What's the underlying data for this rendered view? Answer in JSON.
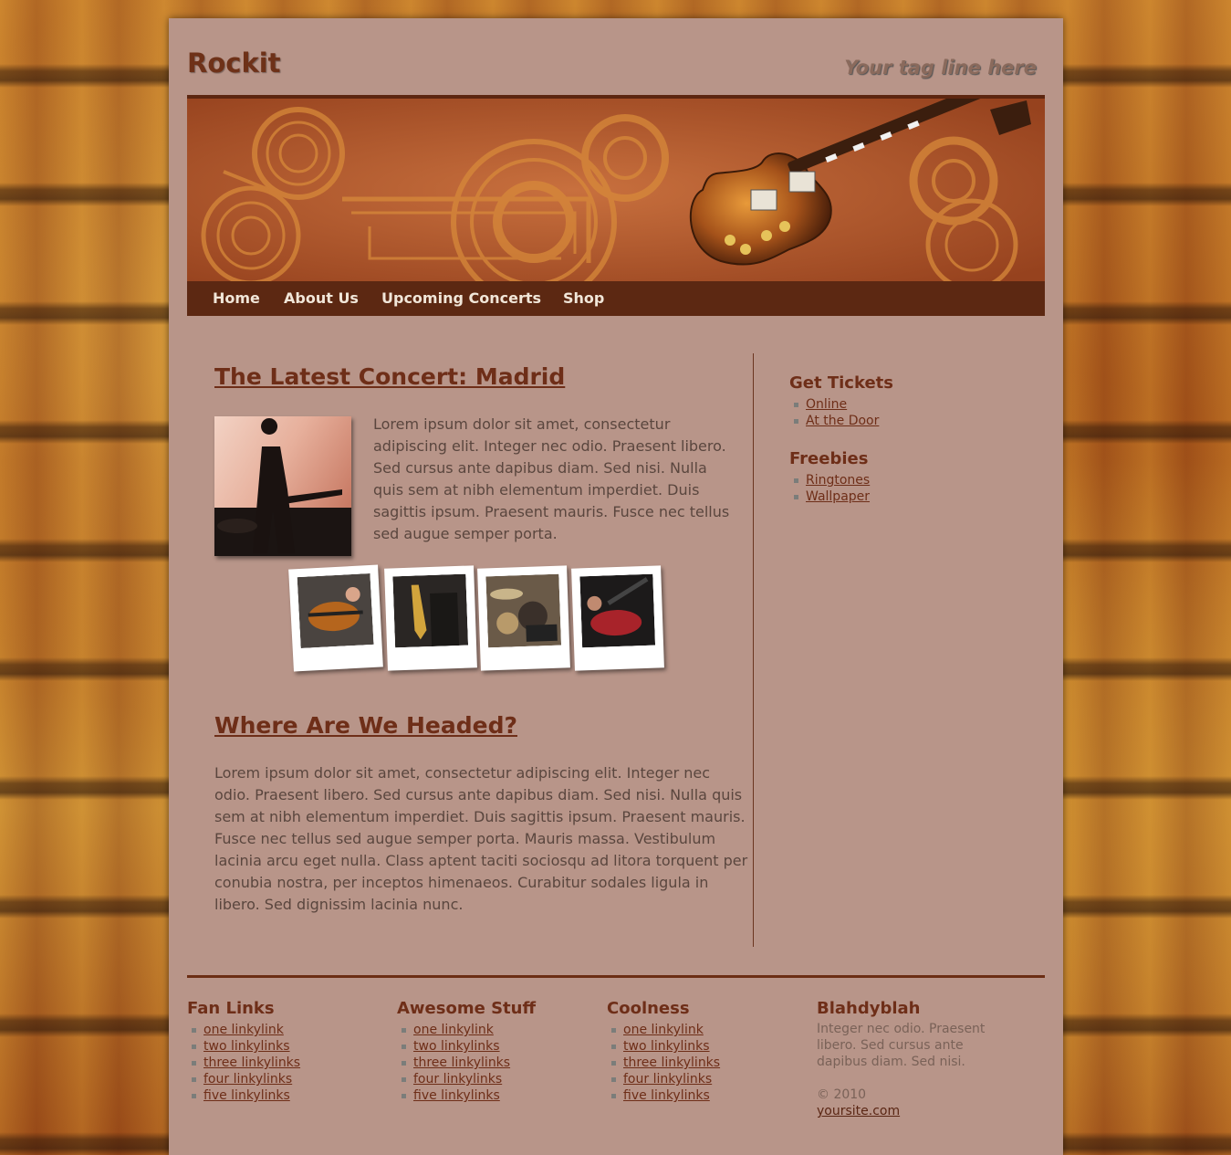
{
  "header": {
    "logo": "Rockit",
    "tagline": "Your tag line here"
  },
  "nav": {
    "items": [
      "Home",
      "About Us",
      "Upcoming Concerts",
      "Shop"
    ]
  },
  "main": {
    "article1": {
      "title": "The Latest Concert: Madrid",
      "body": "Lorem ipsum dolor sit amet, consectetur adipiscing elit. Integer nec odio. Praesent libero. Sed cursus ante dapibus diam. Sed nisi. Nulla quis sem at nibh elementum imperdiet. Duis sagittis ipsum. Praesent mauris. Fusce nec tellus sed augue semper porta."
    },
    "article2": {
      "title": "Where Are We Headed?",
      "body": "Lorem ipsum dolor sit amet, consectetur adipiscing elit. Integer nec odio. Praesent libero. Sed cursus ante dapibus diam. Sed nisi. Nulla quis sem at nibh elementum imperdiet. Duis sagittis ipsum. Praesent mauris. Fusce nec tellus sed augue semper porta. Mauris massa. Vestibulum lacinia arcu eget nulla. Class aptent taciti sociosqu ad litora torquent per conubia nostra, per inceptos himenaeos. Curabitur sodales ligula in libero. Sed dignissim lacinia nunc."
    }
  },
  "sidebar": {
    "sections": [
      {
        "title": "Get Tickets",
        "links": [
          "Online",
          "At the Door"
        ]
      },
      {
        "title": "Freebies",
        "links": [
          "Ringtones",
          "Wallpaper"
        ]
      }
    ]
  },
  "footer": {
    "columns": [
      {
        "title": "Fan Links",
        "links": [
          "one linkylink",
          "two linkylinks",
          "three linkylinks",
          "four linkylinks",
          "five linkylinks"
        ]
      },
      {
        "title": "Awesome Stuff",
        "links": [
          "one linkylink",
          "two linkylinks",
          "three linkylinks",
          "four linkylinks",
          "five linkylinks"
        ]
      },
      {
        "title": "Coolness",
        "links": [
          "one linkylink",
          "two linkylinks",
          "three linkylinks",
          "four linkylinks",
          "five linkylinks"
        ]
      }
    ],
    "blah": {
      "title": "Blahdyblah",
      "text": "Integer nec odio. Praesent libero. Sed cursus ante dapibus diam. Sed nisi.",
      "copyright": "© 2010",
      "site": "yoursite.com"
    }
  },
  "colors": {
    "page": "#b89589",
    "accent": "#6e2e18",
    "nav": "#5c2812",
    "text": "#5a463e"
  }
}
